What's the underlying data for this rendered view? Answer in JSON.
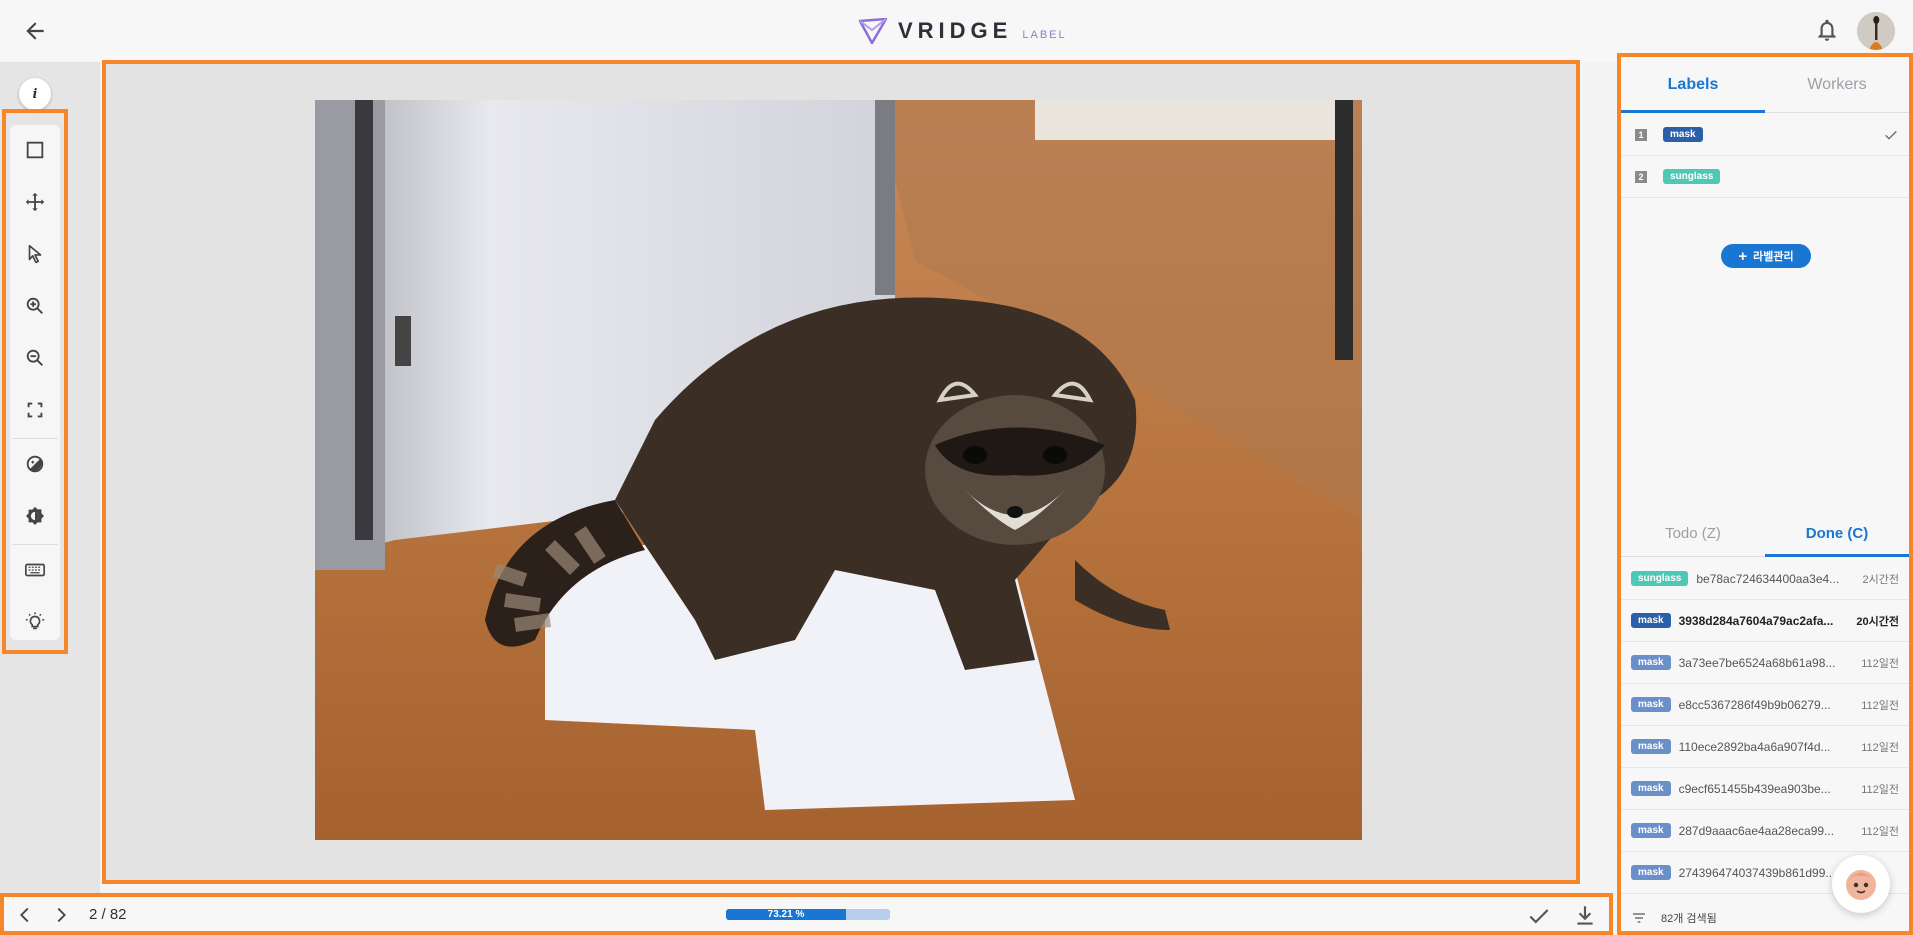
{
  "header": {
    "logo_text": "VRIDGE",
    "logo_sub": "LABEL"
  },
  "toolbar": {
    "info_label": "i",
    "tools": [
      {
        "name": "box-tool",
        "icon": "square-icon"
      },
      {
        "name": "move-tool",
        "icon": "move-icon"
      },
      {
        "name": "select-tool",
        "icon": "cursor-icon"
      },
      {
        "name": "zoom-in-tool",
        "icon": "zoom-in-icon"
      },
      {
        "name": "zoom-out-tool",
        "icon": "zoom-out-icon"
      },
      {
        "name": "fit-screen-tool",
        "icon": "fullscreen-icon"
      },
      {
        "name": "contrast-tool",
        "icon": "contrast-icon"
      },
      {
        "name": "brightness-tool",
        "icon": "brightness-icon"
      },
      {
        "name": "keyboard-shortcuts",
        "icon": "keyboard-icon"
      },
      {
        "name": "tips-tool",
        "icon": "lightbulb-icon"
      }
    ]
  },
  "pager": {
    "page": "2 / 82",
    "progress_text": "73.21 %",
    "progress_value": 0.7321
  },
  "panel": {
    "tabs": [
      "Labels",
      "Workers"
    ],
    "active_tab": "Labels",
    "labels": [
      {
        "num": "1",
        "name": "mask",
        "color": "#2b5fa8",
        "checked": true
      },
      {
        "num": "2",
        "name": "sunglass",
        "color": "#4cc8b4",
        "checked": false
      }
    ],
    "manage_label": "라벨관리",
    "list_tabs": [
      "Todo (Z)",
      "Done (C)"
    ],
    "active_list_tab": "Done (C)",
    "items": [
      {
        "label": "sunglass",
        "color": "#4cc8b4",
        "hash": "be78ac724634400aa3e4...",
        "time": "2시간전",
        "bold": false
      },
      {
        "label": "mask",
        "color": "#2b5fa8",
        "hash": "3938d284a7604a79ac2afa...",
        "time": "20시간전",
        "bold": true
      },
      {
        "label": "mask",
        "color": "#6b8fc9",
        "hash": "3a73ee7be6524a68b61a98...",
        "time": "112일전",
        "bold": false
      },
      {
        "label": "mask",
        "color": "#6b8fc9",
        "hash": "e8cc5367286f49b9b06279...",
        "time": "112일전",
        "bold": false
      },
      {
        "label": "mask",
        "color": "#6b8fc9",
        "hash": "110ece2892ba4a6a907f4d...",
        "time": "112일전",
        "bold": false
      },
      {
        "label": "mask",
        "color": "#6b8fc9",
        "hash": "c9ecf651455b439ea903be...",
        "time": "112일전",
        "bold": false
      },
      {
        "label": "mask",
        "color": "#6b8fc9",
        "hash": "287d9aaac6ae4aa28eca99...",
        "time": "112일전",
        "bold": false
      },
      {
        "label": "mask",
        "color": "#6b8fc9",
        "hash": "274396474037439b861d99...",
        "time": "",
        "bold": false
      }
    ],
    "footer_text": "82개 검색됨"
  },
  "colors": {
    "accent": "#1976d2",
    "highlight": "#f5862a"
  }
}
